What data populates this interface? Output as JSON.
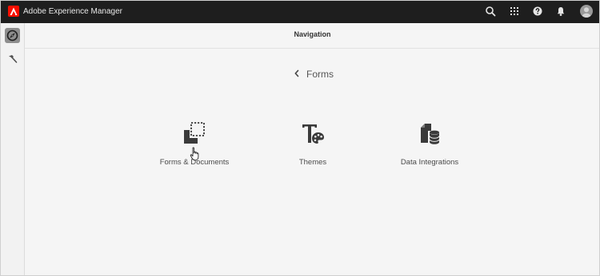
{
  "app": {
    "title": "Adobe Experience Manager",
    "brand_color": "#fa0f00",
    "topbar_color": "#1e1e1e"
  },
  "topbar": {
    "icons": [
      "search-icon",
      "apps-grid-icon",
      "help-icon",
      "notifications-bell-icon",
      "user-avatar"
    ]
  },
  "rail": {
    "items": [
      "navigation-compass-icon",
      "tools-hammer-icon"
    ]
  },
  "header": {
    "title": "Navigation"
  },
  "breadcrumb": {
    "back_icon": "chevron-left-icon",
    "label": "Forms"
  },
  "tiles": [
    {
      "label": "Forms & Documents",
      "icon": "forms-documents-icon"
    },
    {
      "label": "Themes",
      "icon": "themes-icon"
    },
    {
      "label": "Data Integrations",
      "icon": "data-integrations-icon"
    }
  ]
}
